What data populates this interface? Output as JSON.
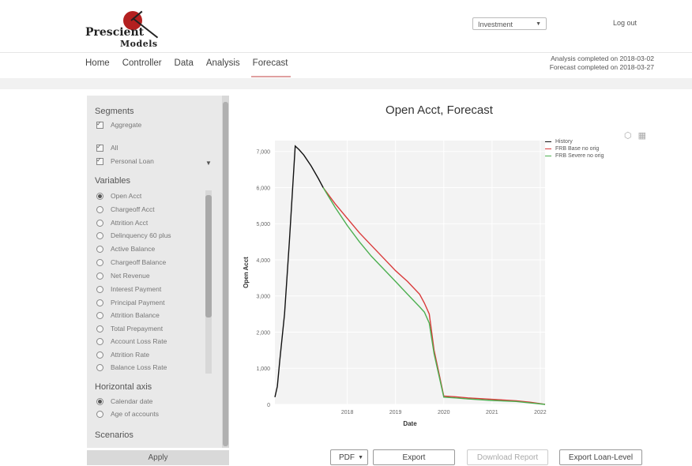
{
  "app": {
    "brand_line1": "Prescient",
    "brand_line2": "Models",
    "portfolio_select": "Investment",
    "logout": "Log out"
  },
  "nav": {
    "items": [
      "Home",
      "Controller",
      "Data",
      "Analysis",
      "Forecast"
    ],
    "active": "Forecast"
  },
  "status": {
    "analysis": "Analysis completed on 2018-03-02",
    "forecast": "Forecast completed on 2018-03-27"
  },
  "sidebar": {
    "segments_title": "Segments",
    "segments": [
      {
        "label": "Aggregate",
        "checked": true
      },
      {
        "label": "All",
        "checked": true
      },
      {
        "label": "Personal Loan",
        "checked": true
      }
    ],
    "variables_title": "Variables",
    "variables": [
      {
        "label": "Open Acct",
        "selected": true
      },
      {
        "label": "Chargeoff Acct",
        "selected": false
      },
      {
        "label": "Attrition Acct",
        "selected": false
      },
      {
        "label": "Delinquency 60 plus",
        "selected": false
      },
      {
        "label": "Active Balance",
        "selected": false
      },
      {
        "label": "Chargeoff Balance",
        "selected": false
      },
      {
        "label": "Net Revenue",
        "selected": false
      },
      {
        "label": "Interest Payment",
        "selected": false
      },
      {
        "label": "Principal Payment",
        "selected": false
      },
      {
        "label": "Attrition Balance",
        "selected": false
      },
      {
        "label": "Total Prepayment",
        "selected": false
      },
      {
        "label": "Account Loss Rate",
        "selected": false
      },
      {
        "label": "Attrition Rate",
        "selected": false
      },
      {
        "label": "Balance Loss Rate",
        "selected": false
      }
    ],
    "horizontal_title": "Horizontal axis",
    "horizontal": [
      {
        "label": "Calendar date",
        "selected": true
      },
      {
        "label": "Age of accounts",
        "selected": false
      }
    ],
    "scenarios_title": "Scenarios",
    "apply": "Apply"
  },
  "toolbar": {
    "format": "PDF",
    "export": "Export",
    "download_report": "Download Report",
    "export_loan_level": "Export Loan-Level"
  },
  "chart_data": {
    "type": "line",
    "title": "Open Acct, Forecast",
    "xlabel": "Date",
    "ylabel": "Open Acct",
    "x_ticks": [
      "2018",
      "2019",
      "2020",
      "2021",
      "2022"
    ],
    "y_ticks": [
      "0",
      "1,000",
      "2,000",
      "3,000",
      "4,000",
      "5,000",
      "6,000",
      "7,000"
    ],
    "xlim": [
      2017.0,
      2022.6
    ],
    "ylim": [
      0,
      7300
    ],
    "grid": true,
    "legend_position": "right",
    "series": [
      {
        "name": "History",
        "color": "#111111",
        "x": [
          2017.0,
          2017.05,
          2017.1,
          2017.2,
          2017.3,
          2017.42,
          2017.5,
          2017.6,
          2017.75,
          2017.9,
          2018.0
        ],
        "y": [
          200,
          500,
          1200,
          2500,
          4500,
          7150,
          7050,
          6900,
          6600,
          6250,
          6000
        ]
      },
      {
        "name": "FRB Base no orig",
        "color": "#d93a3a",
        "x": [
          2018.0,
          2018.25,
          2018.5,
          2018.75,
          2019.0,
          2019.25,
          2019.5,
          2019.75,
          2020.0,
          2020.1,
          2020.2,
          2020.3,
          2020.5,
          2020.75,
          2021.0,
          2021.5,
          2022.0,
          2022.3,
          2022.6
        ],
        "y": [
          6000,
          5550,
          5150,
          4750,
          4400,
          4050,
          3700,
          3400,
          3050,
          2800,
          2500,
          1500,
          230,
          210,
          180,
          140,
          100,
          60,
          0
        ]
      },
      {
        "name": "FRB Severe no orig",
        "color": "#4caf50",
        "x": [
          2018.0,
          2018.25,
          2018.5,
          2018.75,
          2019.0,
          2019.25,
          2019.5,
          2019.75,
          2020.0,
          2020.1,
          2020.2,
          2020.3,
          2020.5,
          2020.75,
          2021.0,
          2021.5,
          2022.0,
          2022.3,
          2022.6
        ],
        "y": [
          6000,
          5450,
          4950,
          4500,
          4100,
          3750,
          3400,
          3050,
          2700,
          2550,
          2250,
          1400,
          200,
          180,
          150,
          110,
          80,
          40,
          0
        ]
      }
    ]
  }
}
